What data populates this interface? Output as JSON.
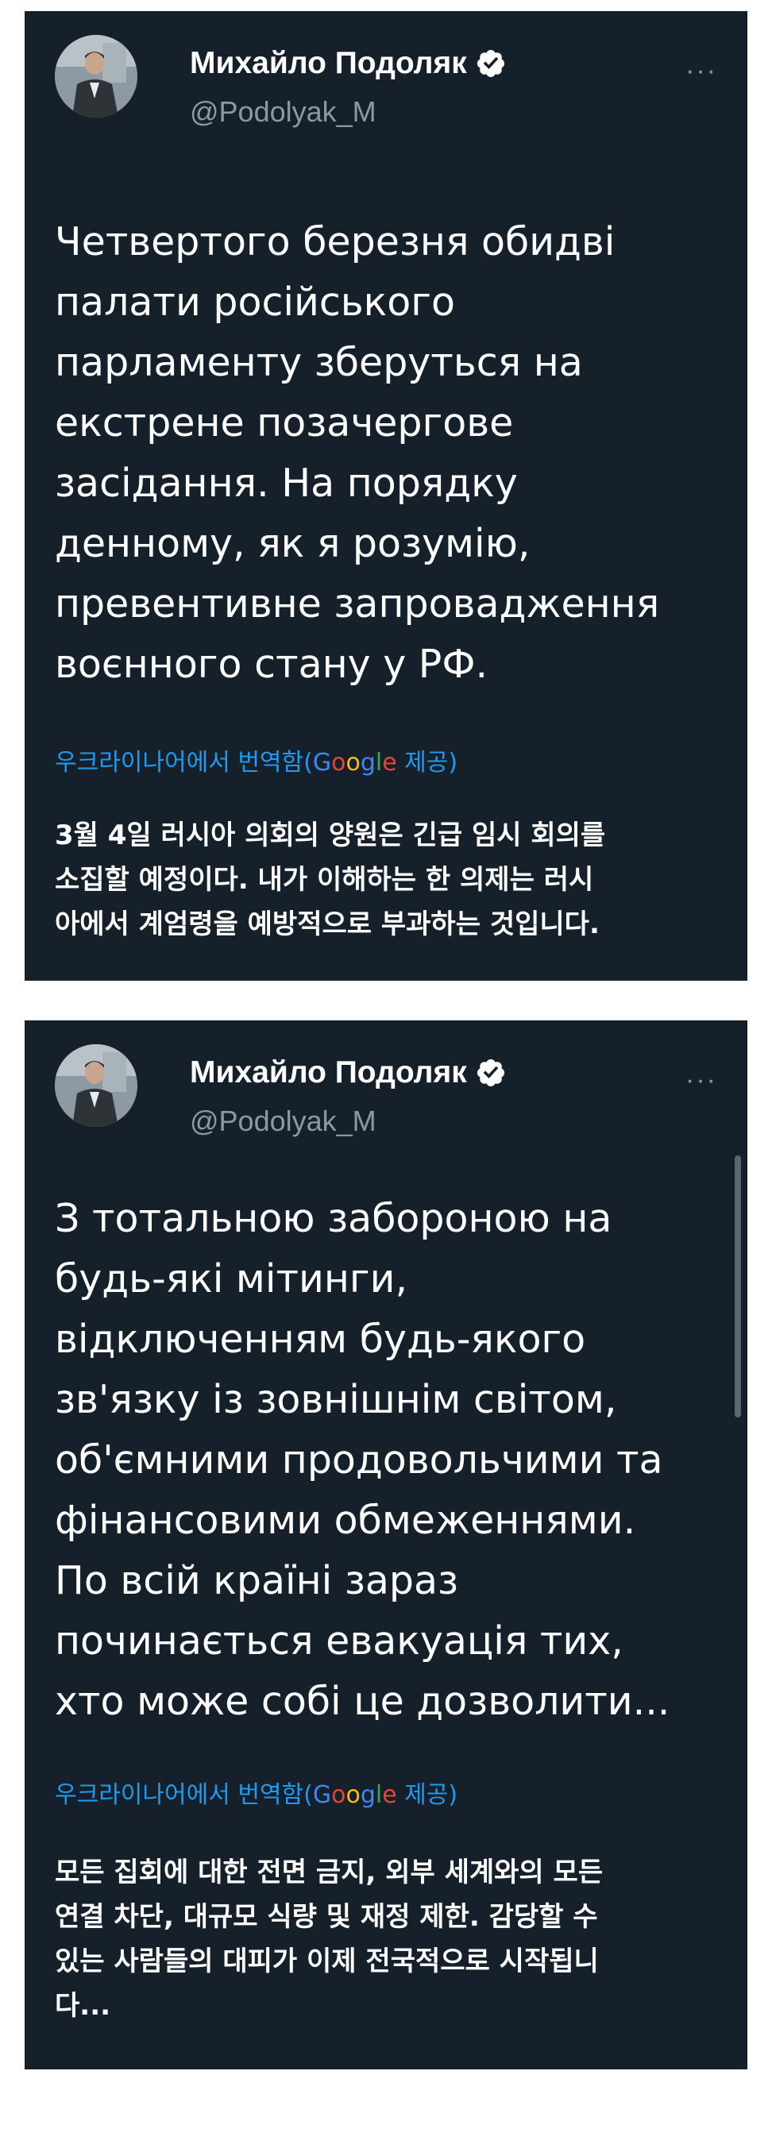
{
  "tweets": [
    {
      "author_name": "Михайло Подоляк",
      "author_handle": "@Podolyak_M",
      "more": "···",
      "text_lines": [
        "Четвертого березня обидві",
        "палати російського",
        "парламенту зберуться на",
        "екстрене позачергове",
        "засідання. На порядку",
        "денному, як я розумію,",
        "превентивне запровадження",
        "воєнного стану у РФ."
      ],
      "translate_prefix": "우크라이나어에서 번역함(",
      "translate_suffix": " 제공)",
      "translation_lines": [
        "3월 4일 러시아 의회의 양원은 긴급 임시 회의를",
        "소집할 예정이다. 내가 이해하는 한 의제는 러시",
        "아에서 계엄령을 예방적으로 부과하는 것입니다."
      ]
    },
    {
      "author_name": "Михайло Подоляк",
      "author_handle": "@Podolyak_M",
      "more": "···",
      "text_lines": [
        "З тотальною забороною на",
        "будь-які мітинги,",
        "відключенням будь-якого",
        "зв'язку із зовнішнім світом,",
        "об'ємними продовольчими та",
        "фінансовими обмеженнями.",
        "По всій країні зараз",
        "починається евакуація тих,",
        "хто може собі це дозволити..."
      ],
      "translate_prefix": "우크라이나어에서 번역함(",
      "translate_suffix": " 제공)",
      "translation_lines": [
        "모든 집회에 대한 전면 금지, 외부 세계와의 모든",
        "연결 차단, 대규모 식량 및 재정 제한. 감당할 수",
        "있는 사람들의 대피가 이제 전국적으로 시작됩니",
        "다..."
      ]
    }
  ],
  "google_logo": {
    "letters": [
      "G",
      "o",
      "o",
      "g",
      "l",
      "e"
    ]
  },
  "colors": {
    "card_background": "#15202b",
    "text": "#ffffff",
    "secondary_text": "#8b98a5",
    "link_blue": "#1d9bf0",
    "verified_badge": "#ffffff"
  },
  "icons": [
    "verified-badge-icon",
    "more-options-icon",
    "google-logo"
  ]
}
